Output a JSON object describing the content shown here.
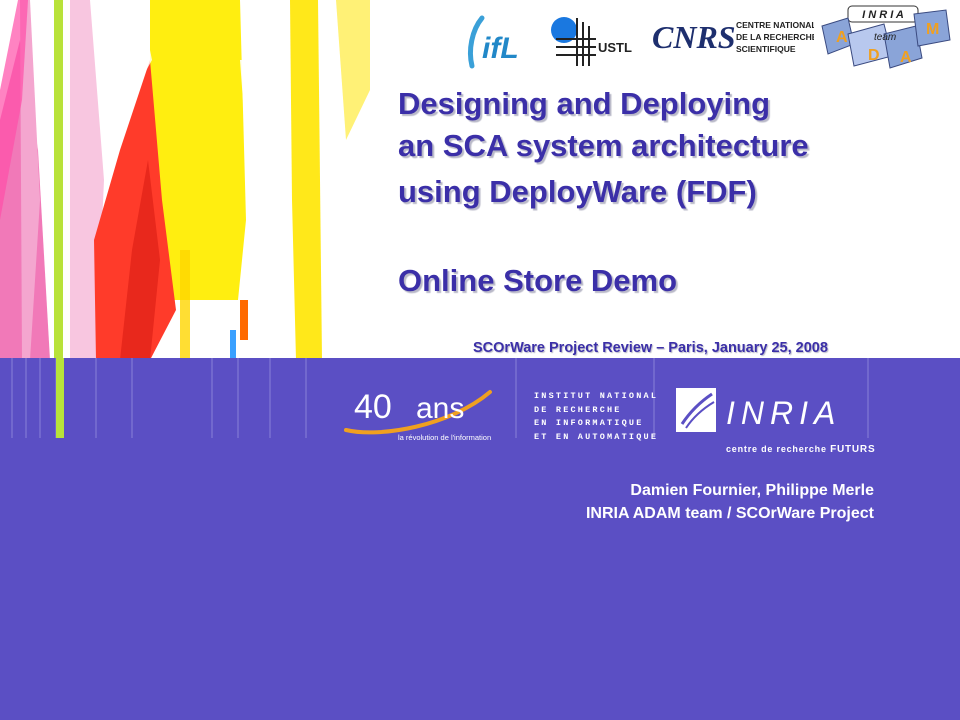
{
  "slide": {
    "title_lines": [
      "Designing and Deploying",
      "an SCA system architecture",
      "using DeployWare (FDF)"
    ],
    "subtitle": "Online Store Demo",
    "event": "SCOrWare Project Review – Paris, January 25, 2008",
    "authors": "Damien Fournier, Philippe Merle",
    "affiliation": "INRIA ADAM team / SCOrWare Project"
  },
  "logos": {
    "ifl": "ifL",
    "ustl": "USTL",
    "cnrs": "CNRS",
    "cnrs_lines": [
      "CENTRE NATIONAL",
      "DE LA RECHERCHE",
      "SCIENTIFIQUE"
    ],
    "adam_header": "I N R I A",
    "adam_letters": [
      "A",
      "D",
      "A",
      "M"
    ],
    "adam_team": "team",
    "anniversary_number": "40",
    "anniversary_word": "ans",
    "anniversary_caption": "la révolution de l'information",
    "institute_lines": [
      "INSTITUT NATIONAL",
      "DE RECHERCHE",
      "EN INFORMATIQUE",
      "ET EN AUTOMATIQUE"
    ],
    "inria": "INRIA",
    "inria_tagline_prefix": "centre de recherche",
    "inria_tagline_suffix": "FUTURS"
  },
  "colors": {
    "title": "#3b2fa8",
    "panel": "#5b4fc4",
    "accent_orange": "#f0a020",
    "art_pink": "#f06ab0",
    "art_yellow": "#ffee10",
    "art_red": "#ff3b2a",
    "art_lime": "#b8e23a"
  }
}
